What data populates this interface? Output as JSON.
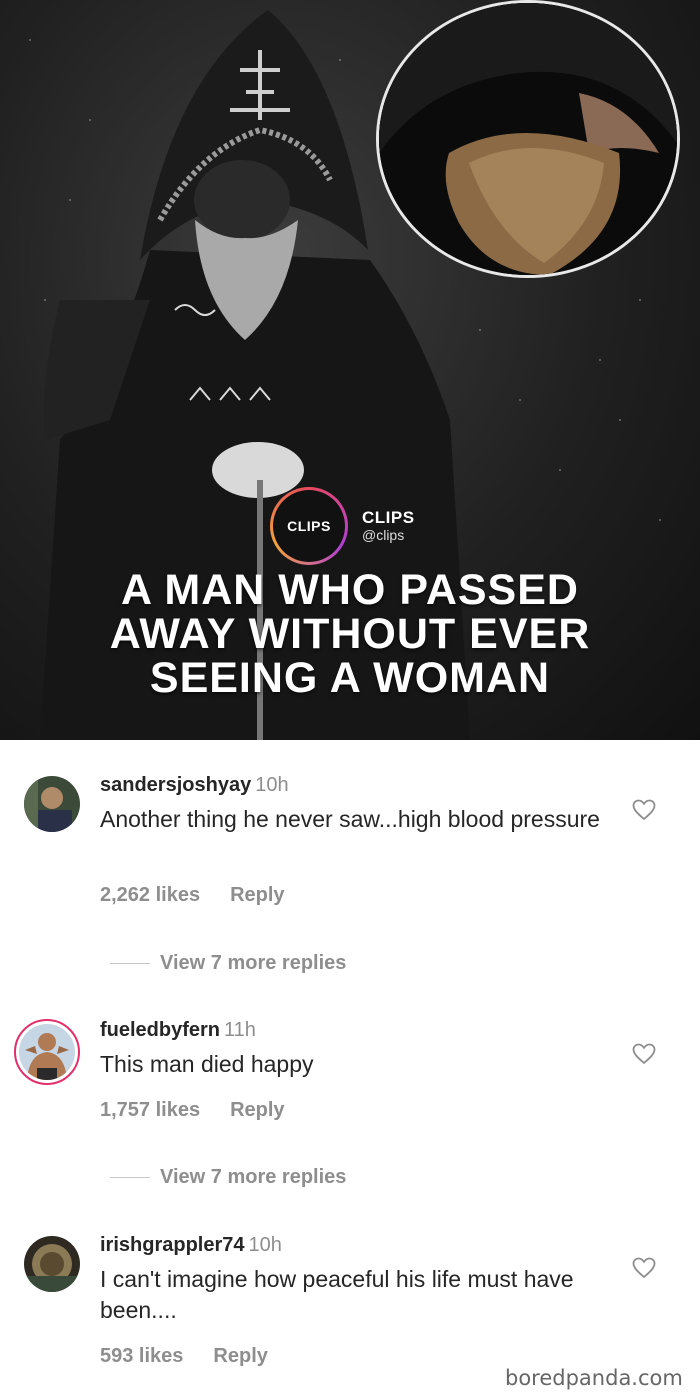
{
  "post": {
    "badge": {
      "logo_text": "CLIPS",
      "name": "CLIPS",
      "handle": "@clips"
    },
    "headline": [
      "A MAN WHO PASSED",
      "AWAY WITHOUT EVER",
      "SEEING A WOMAN"
    ]
  },
  "comments": [
    {
      "username": "sandersjoshyay",
      "time": "10h",
      "text": "Another thing he never saw...high blood pressure",
      "likes": "2,262 likes",
      "reply": "Reply",
      "view_more": "View 7 more replies"
    },
    {
      "username": "fueledbyfern",
      "time": "11h",
      "text": "This man died happy",
      "likes": "1,757 likes",
      "reply": "Reply",
      "view_more": "View 7 more replies"
    },
    {
      "username": "irishgrappler74",
      "time": "10h",
      "text": "I can't imagine how peaceful his life must have been....",
      "likes": "593 likes",
      "reply": "Reply"
    }
  ],
  "watermark": "boredpanda.com",
  "colors": {
    "text_primary": "#262626",
    "text_secondary": "#8e8e8e",
    "story_ring": "#d6249f"
  },
  "icons": [
    "heart-icon"
  ]
}
